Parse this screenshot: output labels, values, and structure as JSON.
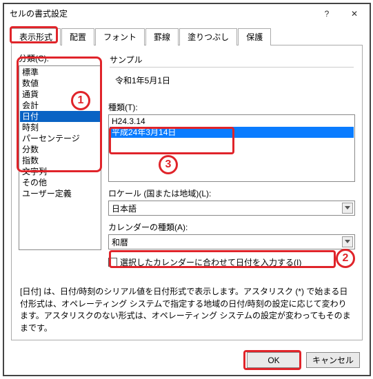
{
  "window": {
    "title": "セルの書式設定"
  },
  "tabs": [
    "表示形式",
    "配置",
    "フォント",
    "罫線",
    "塗りつぶし",
    "保護"
  ],
  "active_tab": 0,
  "category_label": "分類(C):",
  "categories": [
    "標準",
    "数値",
    "通貨",
    "会計",
    "日付",
    "時刻",
    "パーセンテージ",
    "分数",
    "指数",
    "文字列",
    "その他",
    "ユーザー定義"
  ],
  "category_selected_index": 4,
  "sample_label": "サンプル",
  "sample_value": "令和1年5月1日",
  "type_label": "種類(T):",
  "type_items": [
    "H24.3.14",
    "平成24年3月14日"
  ],
  "type_selected_index": 1,
  "locale_label": "ロケール (国または地域)(L):",
  "locale_value": "日本語",
  "calendar_label": "カレンダーの種類(A):",
  "calendar_value": "和暦",
  "calendar_checkbox_label": "選択したカレンダーに合わせて日付を入力する(I)",
  "description": "[日付] は、日付/時刻のシリアル値を日付形式で表示します。アスタリスク (*) で始まる日付形式は、オペレーティング システムで指定する地域の日付/時刻の設定に応じて変わります。アスタリスクのない形式は、オペレーティング システムの設定が変わってもそのままです。",
  "buttons": {
    "ok": "OK",
    "cancel": "キャンセル"
  },
  "annotations": {
    "n1": "1",
    "n2": "2",
    "n3": "3"
  }
}
